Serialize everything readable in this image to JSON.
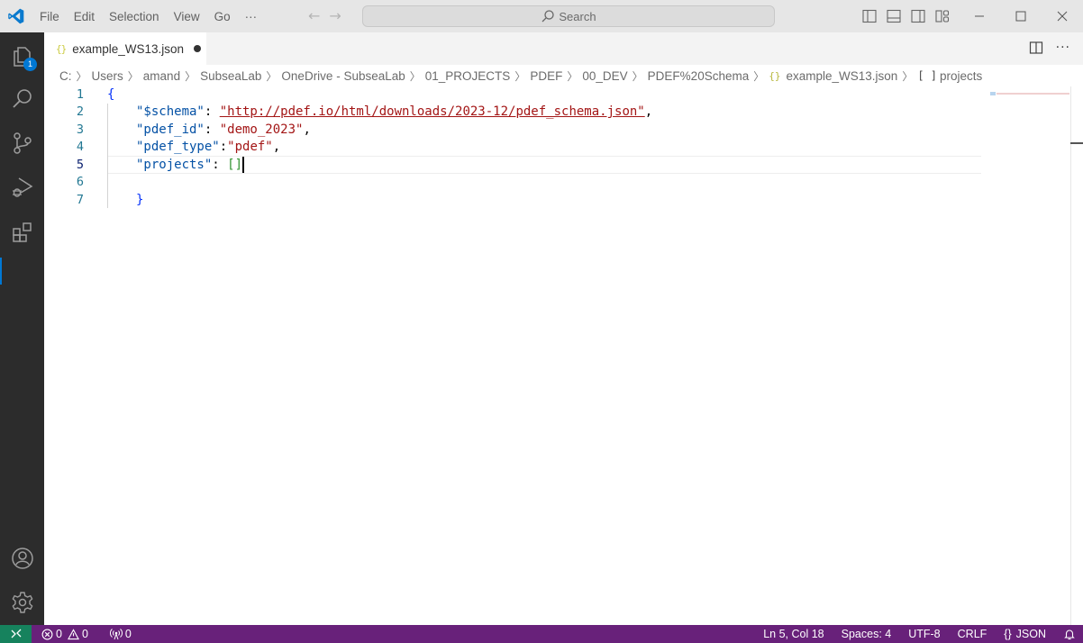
{
  "titlebar": {
    "menu": [
      "File",
      "Edit",
      "Selection",
      "View",
      "Go",
      "···"
    ],
    "search_placeholder": "Search",
    "nav_back": "←",
    "nav_forward": "→"
  },
  "activitybar": {
    "items": [
      "explorer",
      "search",
      "source-control",
      "run-and-debug",
      "extensions"
    ],
    "explorer_badge": "1",
    "bottom_items": [
      "accounts",
      "manage"
    ]
  },
  "tabs": [
    {
      "label": "example_WS13.json",
      "icon": "{}",
      "dirty": true,
      "active": true
    }
  ],
  "breadcrumb": {
    "segments": [
      "C:",
      "Users",
      "amand",
      "SubseaLab",
      "OneDrive - SubseaLab",
      "01_PROJECTS",
      "PDEF",
      "00_DEV",
      "PDEF%20Schema"
    ],
    "file": "example_WS13.json",
    "file_icon": "{}",
    "symbol": "projects",
    "symbol_icon": "[ ]"
  },
  "editor": {
    "lines": [
      {
        "n": "1"
      },
      {
        "n": "2",
        "key": "\"$schema\"",
        "colon": ": ",
        "value": "\"http://pdef.io/html/downloads/2023-12/pdef_schema.json\"",
        "comma": ","
      },
      {
        "n": "3",
        "key": "\"pdef_id\"",
        "colon": ": ",
        "value": "\"demo_2023\"",
        "comma": ","
      },
      {
        "n": "4",
        "key": "\"pdef_type\"",
        "colon": ":",
        "value": "\"pdef\"",
        "comma": ","
      },
      {
        "n": "5",
        "key": "\"projects\"",
        "colon": ": ",
        "value": "[]"
      },
      {
        "n": "6"
      },
      {
        "n": "7"
      }
    ],
    "open_brace": "{",
    "close_brace": "}",
    "active_line": 5
  },
  "statusbar": {
    "errors": "0",
    "warnings": "0",
    "ports": "0",
    "cursor_position": "Ln 5, Col 18",
    "indentation": "Spaces: 4",
    "encoding": "UTF-8",
    "eol": "CRLF",
    "language": "JSON",
    "language_icon": "{}"
  },
  "colors": {
    "statusbar_bg": "#68217a",
    "remote_bg": "#16825d",
    "activitybar_bg": "#2c2c2c",
    "accent": "#0078d4"
  }
}
